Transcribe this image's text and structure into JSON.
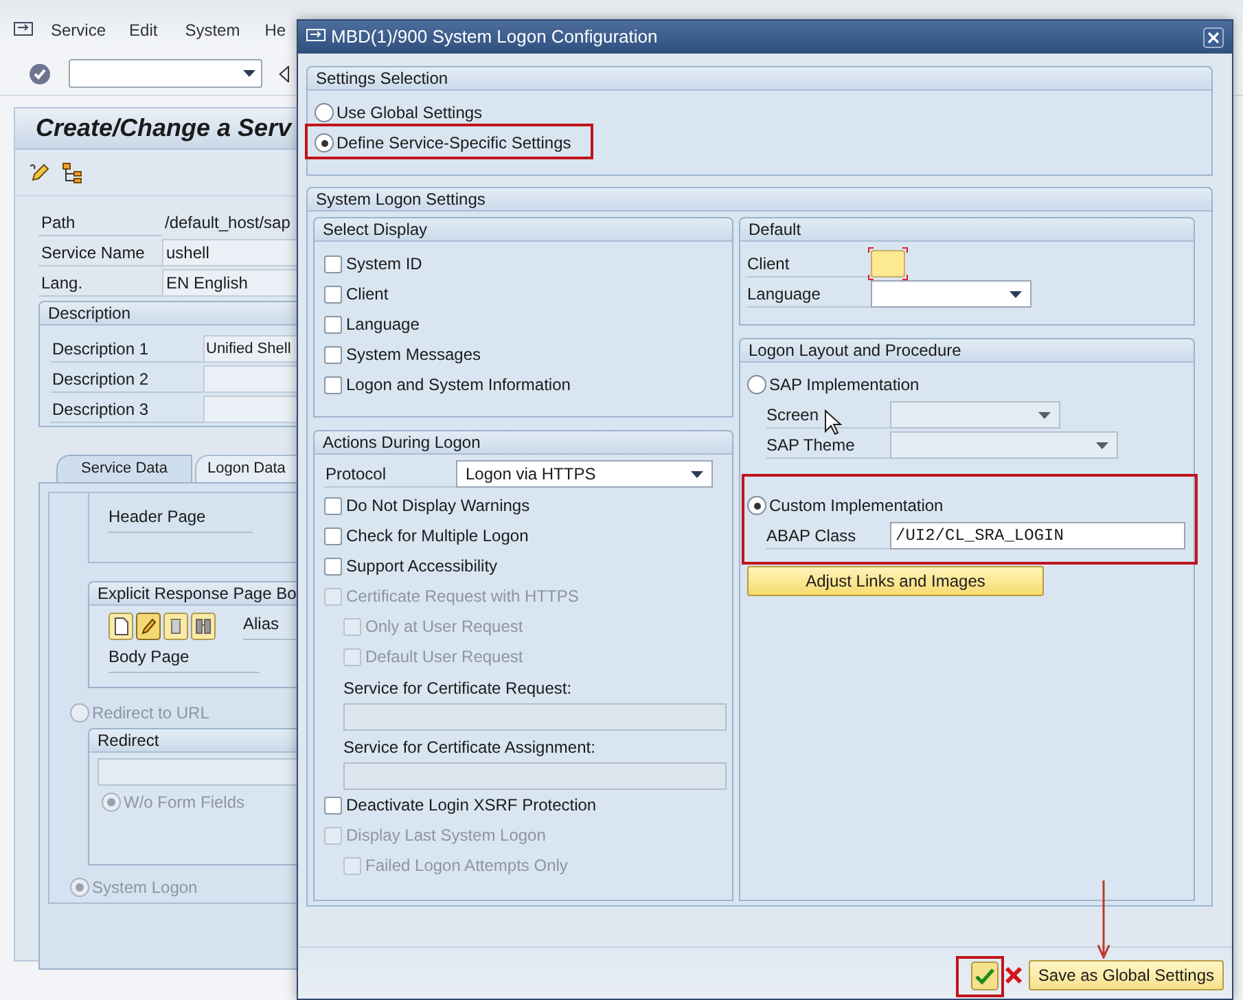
{
  "menu_bar": {
    "items": [
      {
        "label": "Service"
      },
      {
        "label": "Edit"
      },
      {
        "label": "System"
      },
      {
        "label": "He"
      }
    ]
  },
  "header": {
    "title": "Create/Change a Serv"
  },
  "fields": [
    {
      "label": "Path",
      "value": "/default_host/sap",
      "kind": "text"
    },
    {
      "label": "Service Name",
      "value": "ushell",
      "kind": "input"
    },
    {
      "label": "Lang.",
      "value": "EN English",
      "kind": "input"
    }
  ],
  "description": {
    "title": "Description",
    "rows": [
      {
        "label": "Description 1",
        "value": "Unified Shell"
      },
      {
        "label": "Description 2"
      },
      {
        "label": "Description 3"
      }
    ]
  },
  "tabs": [
    {
      "label": "Service Data",
      "selected": true
    },
    {
      "label": "Logon Data",
      "selected": false
    }
  ],
  "tab_content": {
    "header_page": "Header Page",
    "body_group": {
      "title": "Explicit Response Page Bo",
      "alias": "Alias",
      "body_page": "Body Page"
    },
    "redirect_option": {
      "label": "Redirect to URL",
      "selected": false,
      "disabled": true
    },
    "redirect_group": {
      "title": "Redirect",
      "form_fields": {
        "label": "W/o Form Fields",
        "selected": true,
        "disabled": true
      }
    },
    "system_logon_option": {
      "label": "System Logon",
      "selected": true,
      "disabled": true
    }
  },
  "dialog": {
    "title": "MBD(1)/900 System Logon Configuration",
    "settings_selection": {
      "title": "Settings Selection",
      "options": [
        {
          "label": "Use Global Settings",
          "selected": false,
          "highlighted": false
        },
        {
          "label": "Define Service-Specific Settings",
          "selected": true,
          "highlighted": true
        }
      ]
    },
    "system_logon_settings": {
      "title": "System Logon Settings",
      "select_display": {
        "title": "Select Display",
        "items": [
          {
            "label": "System ID",
            "checked": false
          },
          {
            "label": "Client",
            "checked": false
          },
          {
            "label": "Language",
            "checked": false
          },
          {
            "label": "System Messages",
            "checked": false
          },
          {
            "label": "Logon and System Information",
            "checked": false
          }
        ]
      },
      "actions": {
        "title": "Actions During Logon",
        "protocol": {
          "label": "Protocol",
          "value": "Logon via HTTPS"
        },
        "items": [
          {
            "kind": "checkbox",
            "label": "Do Not Display Warnings",
            "checked": false,
            "disabled": false
          },
          {
            "kind": "checkbox",
            "label": "Check for Multiple Logon",
            "checked": false,
            "disabled": false
          },
          {
            "kind": "checkbox",
            "label": "Support Accessibility",
            "checked": false,
            "disabled": false
          },
          {
            "kind": "checkbox",
            "label": "Certificate Request with HTTPS",
            "checked": false,
            "disabled": true,
            "children": [
              {
                "kind": "checkbox",
                "label": "Only at User Request",
                "checked": false,
                "disabled": true
              },
              {
                "kind": "checkbox",
                "label": "Default User Request",
                "checked": false,
                "disabled": true
              },
              {
                "kind": "field",
                "label": "Service for Certificate Request:",
                "disabled": true
              },
              {
                "kind": "field",
                "label": "Service for Certificate Assignment:",
                "disabled": true
              }
            ]
          },
          {
            "kind": "checkbox",
            "label": "Deactivate Login XSRF Protection",
            "checked": false,
            "disabled": false
          },
          {
            "kind": "checkbox",
            "label": "Display Last System Logon",
            "checked": false,
            "disabled": true,
            "children": [
              {
                "kind": "checkbox",
                "label": "Failed Logon Attempts Only",
                "checked": false,
                "disabled": true
              }
            ]
          }
        ]
      },
      "default": {
        "title": "Default",
        "fields": [
          {
            "label": "Client",
            "kind": "input",
            "focused": true
          },
          {
            "label": "Language",
            "kind": "dropdown",
            "focused": false
          }
        ]
      },
      "logon_layout": {
        "title": "Logon Layout and Procedure",
        "options": [
          {
            "label": "SAP Implementation",
            "selected": false,
            "highlighted": false,
            "fields": [
              {
                "label": "Screen",
                "kind": "dropdown",
                "disabled": true
              },
              {
                "label": "SAP Theme",
                "kind": "dropdown",
                "disabled": true
              }
            ]
          },
          {
            "label": "Custom Implementation",
            "selected": true,
            "highlighted": true,
            "fields": [
              {
                "label": "ABAP Class",
                "kind": "input",
                "value": "/UI2/CL_SRA_LOGIN",
                "disabled": false
              }
            ]
          }
        ],
        "button": "Adjust Links and Images"
      }
    },
    "footer": {
      "buttons": [
        {
          "kind": "ok",
          "highlighted": true,
          "pointed": false
        },
        {
          "kind": "cancel",
          "highlighted": false,
          "pointed": false
        },
        {
          "kind": "text",
          "label": "Save as Global Settings",
          "highlighted": false,
          "pointed": true
        }
      ]
    }
  }
}
